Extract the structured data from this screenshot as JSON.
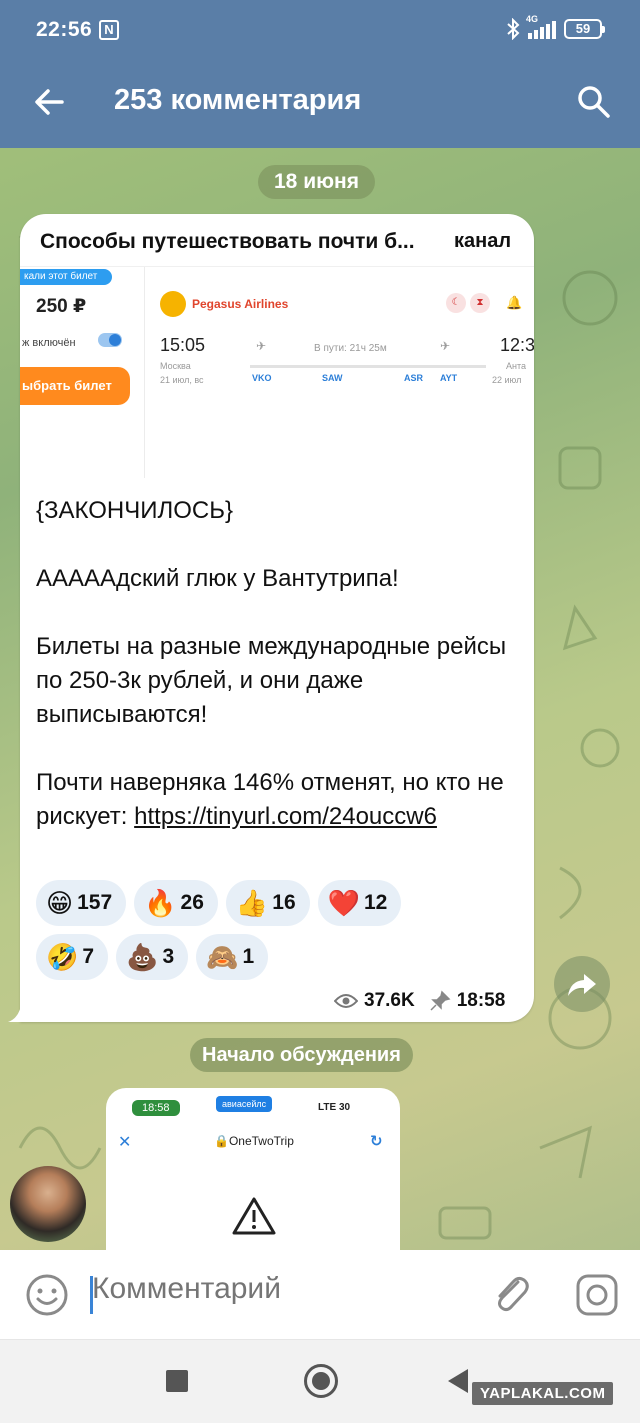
{
  "status_bar": {
    "time": "22:56",
    "nfc_icon": "N",
    "network": "4G",
    "battery": "59"
  },
  "header": {
    "title": "253 комментария",
    "back_icon": "arrow-left-icon",
    "search_icon": "search-icon"
  },
  "date_separator": "18 июня",
  "post": {
    "link_preview": {
      "title": "Способы путешествовать почти б...",
      "badge": "канал",
      "image": {
        "tag": "кали этот билет",
        "price": "250 ₽",
        "toggle_label": "ж включён",
        "buy_button": "ыбрать билет",
        "airline": "Pegasus Airlines",
        "departure_time": "15:05",
        "departure_city": "Москва",
        "departure_date": "21 июл, вс",
        "arrival_time": "12:3",
        "arrival_city": "Анта",
        "arrival_date": "22 июл",
        "duration": "В пути: 21ч 25м",
        "codes": [
          "VKO",
          "SAW",
          "ASR",
          "AYT"
        ]
      }
    },
    "paragraphs": [
      "{ЗАКОНЧИЛОСЬ}",
      "ААААAдский глюк у Вантутрипа!",
      "Билеты на разные международные рейсы по 250-3к рублей, и они даже выписываются!"
    ],
    "last_paragraph_text": "Почти наверняка 146% отменят, но кто не рискует: ",
    "link": "https://tinyurl.com/24ouccw6",
    "reactions": [
      {
        "emoji": "😁",
        "count": "157"
      },
      {
        "emoji": "🔥",
        "count": "26"
      },
      {
        "emoji": "👍",
        "count": "16"
      },
      {
        "emoji": "❤️",
        "count": "12"
      },
      {
        "emoji": "🤣",
        "count": "7"
      },
      {
        "emoji": "💩",
        "count": "3"
      },
      {
        "emoji": "🙈",
        "count": "1"
      }
    ],
    "views": "37.6K",
    "time": "18:58"
  },
  "discussion_label": "Начало обсуждения",
  "reply_preview": {
    "time": "18:58",
    "app": "авиасейлс",
    "network": "LTE",
    "battery": "30",
    "site": "OneTwoTrip"
  },
  "input": {
    "placeholder": "Комментарий"
  },
  "watermark": "YAPLAKAL.COM"
}
